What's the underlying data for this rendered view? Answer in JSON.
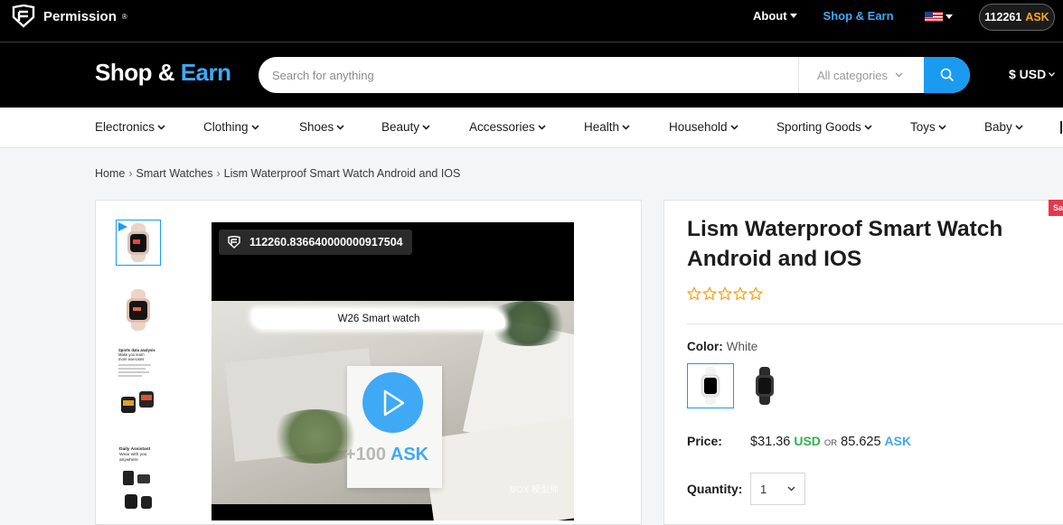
{
  "topbar": {
    "brand_name": "Permission",
    "brand_mark": "®",
    "nav_about": "About",
    "nav_shop_earn": "Shop & Earn",
    "balance_value": "112261",
    "balance_unit": "ASK"
  },
  "header": {
    "brand_left": "Shop & ",
    "brand_right": "Earn",
    "search_placeholder": "Search for anything",
    "category_select": "All categories",
    "currency": "$ USD"
  },
  "categories": [
    "Electronics",
    "Clothing",
    "Shoes",
    "Beauty",
    "Accessories",
    "Health",
    "Household",
    "Sporting Goods",
    "Toys",
    "Baby"
  ],
  "breadcrumb": {
    "home": "Home",
    "category": "Smart Watches",
    "current": "Lism Waterproof Smart Watch Android and IOS",
    "separator": "›"
  },
  "video": {
    "badge_value": "112260.836640000000917504",
    "caption": "W26 Smart watch",
    "reward_prefix": "+100",
    "reward_unit": "ASK",
    "watermark": "BOX 模型师"
  },
  "thumbnails": {
    "thumb3_text": "Sports data analysis Make you learn more exercises",
    "thumb4_text": "Daily Assistant Wear with you anywhere"
  },
  "product": {
    "sale_tag": "Sa",
    "title": "Lism Waterproof Smart Watch Android and IOS",
    "rating_stars": 0,
    "color_label": "Color:",
    "color_value": "White",
    "price_label": "Price:",
    "price_usd": "$31.36",
    "price_usd_unit": "USD",
    "price_or": "OR",
    "price_ask": "85.625",
    "price_ask_unit": "ASK",
    "quantity_label": "Quantity:",
    "quantity_value": "1"
  },
  "colors": {
    "accent_blue": "#1a9bf0",
    "ask_orange": "#f5a623",
    "usd_green": "#30b24a",
    "sale_red": "#e8364f",
    "star_orange": "#f5a623"
  }
}
